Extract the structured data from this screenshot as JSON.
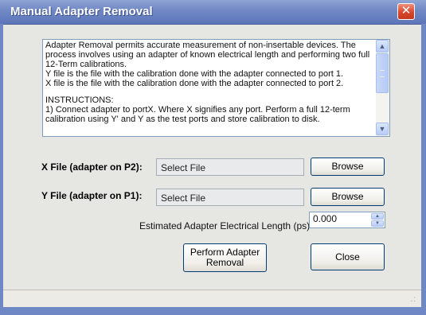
{
  "window": {
    "title": "Manual Adapter Removal",
    "close_glyph": "✕"
  },
  "description": {
    "lines": [
      "Adapter Removal permits accurate measurement of non-insertable devices.  The",
      "process involves using an adapter of known electrical length and performing two full",
      "12-Term calibrations.",
      "Y file is the file with the calibration done with the adapter connected to port 1.",
      "X file is the file with the calibration done with the adapter connected to port 2.",
      "INSTRUCTIONS:",
      "1) Connect adapter to portX.  Where X signifies any port.  Perform a full 12-term",
      "calibration using Y' and Y as the test ports and store calibration to disk."
    ],
    "scroll_up_glyph": "▲",
    "scroll_down_glyph": "▼"
  },
  "x_file": {
    "label": "X File (adapter on P2):",
    "value": "Select File",
    "browse_label": "Browse"
  },
  "y_file": {
    "label": "Y File (adapter on P1):",
    "value": "Select File",
    "browse_label": "Browse"
  },
  "length": {
    "label": "Estimated Adapter Electrical Length (ps)",
    "value": "0.000"
  },
  "actions": {
    "perform_line1": "Perform Adapter",
    "perform_line2": "Removal",
    "close_label": "Close"
  },
  "statusbar": {
    "grip_glyph": ".:"
  },
  "colors": {
    "title_bar": "#6f87c4",
    "close_button": "#d8452c",
    "dialog_background": "#e6e6e2",
    "button_border": "#003c74"
  },
  "icons": [
    "close-icon",
    "scroll-up-arrow-icon",
    "scroll-down-arrow-icon",
    "spin-up-arrow-icon",
    "spin-down-arrow-icon",
    "resize-grip-icon"
  ]
}
